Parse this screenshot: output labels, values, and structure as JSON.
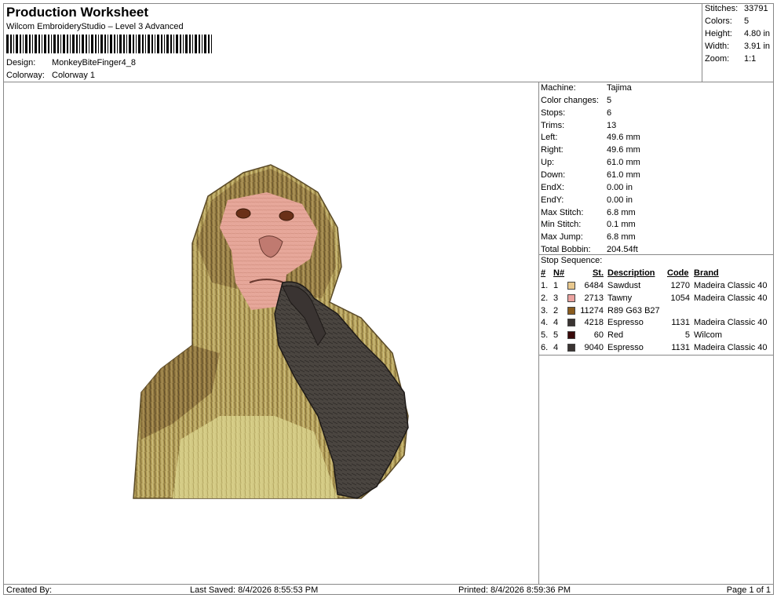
{
  "header": {
    "title": "Production Worksheet",
    "software": "Wilcom EmbroideryStudio – Level 3 Advanced",
    "design_label": "Design:",
    "design_value": "MonkeyBiteFinger4_8",
    "colorway_label": "Colorway:",
    "colorway_value": "Colorway 1"
  },
  "summary": [
    {
      "label": "Stitches:",
      "value": "33791"
    },
    {
      "label": "Colors:",
      "value": "5"
    },
    {
      "label": "Height:",
      "value": "4.80 in"
    },
    {
      "label": "Width:",
      "value": "3.91 in"
    },
    {
      "label": "Zoom:",
      "value": "1:1"
    }
  ],
  "machine_info": [
    {
      "label": "Machine:",
      "value": "Tajima"
    },
    {
      "label": "Color changes:",
      "value": "5"
    },
    {
      "label": "Stops:",
      "value": "6"
    },
    {
      "label": "Trims:",
      "value": "13"
    },
    {
      "label": "Left:",
      "value": "49.6 mm"
    },
    {
      "label": "Right:",
      "value": "49.6 mm"
    },
    {
      "label": "Up:",
      "value": "61.0 mm"
    },
    {
      "label": "Down:",
      "value": "61.0 mm"
    },
    {
      "label": "EndX:",
      "value": "0.00 in"
    },
    {
      "label": "EndY:",
      "value": "0.00 in"
    },
    {
      "label": "Max Stitch:",
      "value": "6.8 mm"
    },
    {
      "label": "Min Stitch:",
      "value": "0.1 mm"
    },
    {
      "label": "Max Jump:",
      "value": "6.8 mm"
    },
    {
      "label": "Total Bobbin:",
      "value": "204.54ft"
    }
  ],
  "stop_sequence": {
    "title": "Stop Sequence:",
    "headers": {
      "num": "#",
      "nnum": "N#",
      "st": "St.",
      "desc": "Description",
      "code": "Code",
      "brand": "Brand"
    },
    "rows": [
      {
        "num": "1.",
        "n": "1",
        "st": "6484",
        "desc": "Sawdust",
        "code": "1270",
        "brand": "Madeira Classic 40",
        "color": "#e8c88e"
      },
      {
        "num": "2.",
        "n": "3",
        "st": "2713",
        "desc": "Tawny",
        "code": "1054",
        "brand": "Madeira Classic 40",
        "color": "#eba3a0"
      },
      {
        "num": "3.",
        "n": "2",
        "st": "11274",
        "desc": "R89 G63 B27",
        "code": "",
        "brand": "",
        "color": "#8a5c1e"
      },
      {
        "num": "4.",
        "n": "4",
        "st": "4218",
        "desc": "Espresso",
        "code": "1131",
        "brand": "Madeira Classic 40",
        "color": "#3a3432"
      },
      {
        "num": "5.",
        "n": "5",
        "st": "60",
        "desc": "Red",
        "code": "5",
        "brand": "Wilcom",
        "color": "#3a0a0a"
      },
      {
        "num": "6.",
        "n": "4",
        "st": "9040",
        "desc": "Espresso",
        "code": "1131",
        "brand": "Madeira Classic 40",
        "color": "#3a3432"
      }
    ]
  },
  "footer": {
    "created_by": "Created By:",
    "last_saved": "Last Saved: 8/4/2026 8:55:53 PM",
    "printed": "Printed: 8/4/2026 8:59:36 PM",
    "page": "Page 1 of 1"
  }
}
